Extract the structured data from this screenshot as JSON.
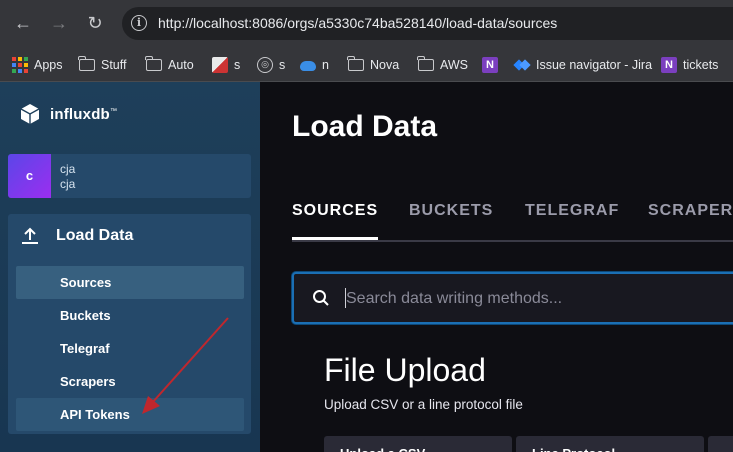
{
  "browser": {
    "url": "http://localhost:8086/orgs/a5330c74ba528140/load-data/sources",
    "info_glyph": "i",
    "bookmarks": [
      {
        "label": "Apps",
        "icon": "apps-grid-icon"
      },
      {
        "label": "Stuff",
        "icon": "folder-icon"
      },
      {
        "label": "Auto",
        "icon": "folder-icon"
      },
      {
        "label": "s",
        "icon": "site-image-icon"
      },
      {
        "label": "s",
        "icon": "globe-icon"
      },
      {
        "label": "n",
        "icon": "cloud-icon"
      },
      {
        "label": "Nova",
        "icon": "folder-icon"
      },
      {
        "label": "AWS",
        "icon": "folder-icon"
      },
      {
        "label": "",
        "icon": "onenote-icon"
      },
      {
        "label": "Issue navigator - Jira",
        "icon": "jira-icon"
      },
      {
        "label": "tickets",
        "icon": "onenote-icon"
      }
    ]
  },
  "sidebar": {
    "logo_text": "influxdb",
    "logo_mark": "™",
    "user": {
      "initial": "c",
      "name": "cja",
      "org": "cja"
    },
    "section": "Load Data",
    "items": [
      "Sources",
      "Buckets",
      "Telegraf",
      "Scrapers",
      "API Tokens"
    ],
    "active_item": "Sources"
  },
  "main": {
    "title": "Load Data",
    "tabs": [
      "SOURCES",
      "BUCKETS",
      "TELEGRAF",
      "SCRAPERS"
    ],
    "active_tab": "SOURCES",
    "search_placeholder": "Search data writing methods...",
    "section_title": "File Upload",
    "section_subtitle": "Upload CSV or a line protocol file",
    "cards": [
      "Upload a CSV",
      "Line Protocol"
    ]
  },
  "colors": {
    "sidebar": "#1e3f5a",
    "main_bg": "#0e0e13",
    "search_border": "#1b6fb4",
    "annotation_arrow": "#c0272d"
  }
}
